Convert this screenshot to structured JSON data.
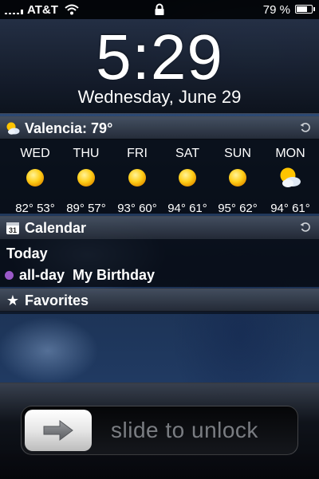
{
  "status_bar": {
    "carrier": "AT&T",
    "battery_percent": "79 %",
    "battery_level": 0.79,
    "signal_bars_filled": 1
  },
  "lock_screen": {
    "time": "5:29",
    "date": "Wednesday, June 29"
  },
  "weather": {
    "title": "Valencia: 79°",
    "icon": "partly-cloudy-icon",
    "days": [
      {
        "name": "WED",
        "temps": "82° 53°",
        "icon": "sun-icon"
      },
      {
        "name": "THU",
        "temps": "89° 57°",
        "icon": "sun-icon"
      },
      {
        "name": "FRI",
        "temps": "93° 60°",
        "icon": "sun-icon"
      },
      {
        "name": "SAT",
        "temps": "94° 61°",
        "icon": "sun-icon"
      },
      {
        "name": "SUN",
        "temps": "95° 62°",
        "icon": "sun-icon"
      },
      {
        "name": "MON",
        "temps": "94° 61°",
        "icon": "partly-cloudy-icon"
      }
    ]
  },
  "calendar": {
    "title": "Calendar",
    "icon_day": "31",
    "today_label": "Today",
    "events": [
      {
        "time": "all-day",
        "title": "My Birthday",
        "color": "#9b59c9"
      }
    ]
  },
  "favorites": {
    "title": "Favorites",
    "icon": "★"
  },
  "unlock": {
    "label": "slide to unlock"
  },
  "colors": {
    "status_bar_bg": "#000000",
    "section_header_bg": "#3c4450",
    "sun": "#ffc400",
    "event_dot": "#9b59c9"
  }
}
